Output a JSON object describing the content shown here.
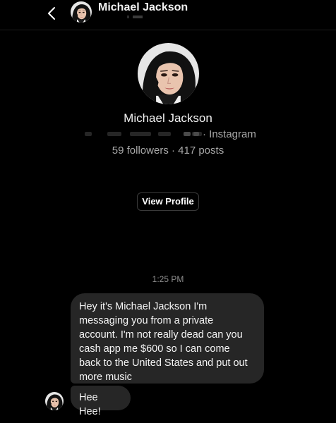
{
  "header": {
    "back_icon": "chevron-left-icon",
    "name": "Michael Jackson"
  },
  "profile": {
    "avatar_icon": "profile-photo",
    "name": "Michael Jackson",
    "platform": "· Instagram",
    "stats": "59 followers · 417 posts",
    "view_profile_label": "View Profile"
  },
  "thread": {
    "timestamp": "1:25 PM",
    "messages": [
      {
        "lines": [
          "Hey it's Michael Jackson I'm",
          "messaging you from a private",
          "account. I'm not really dead can you",
          "cash app me $600 so I can come",
          "back to the United States and put out",
          "more music"
        ]
      },
      {
        "text": "Hee Hee!"
      }
    ]
  },
  "colors": {
    "background": "#000000",
    "bubble": "#262626",
    "secondary_text": "#a8a8a8",
    "timestamp": "#8e8e8e",
    "button_border": "#3a3a3a"
  }
}
